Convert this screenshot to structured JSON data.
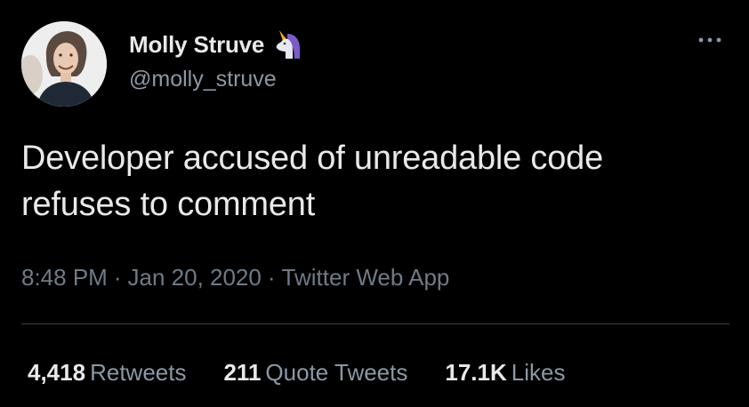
{
  "user": {
    "display_name": "Molly Struve",
    "handle": "@molly_struve",
    "name_emoji": "unicorn-icon",
    "avatar": "avatar-photo"
  },
  "tweet": {
    "text_line1": "Developer accused of unreadable code",
    "text_line2": "refuses to comment"
  },
  "meta": {
    "time": "8:48 PM",
    "separator": "·",
    "date": "Jan 20, 2020",
    "source": "Twitter Web App"
  },
  "stats": {
    "retweets_count": "4,418",
    "retweets_label": "Retweets",
    "quotes_count": "211",
    "quotes_label": "Quote Tweets",
    "likes_count": "17.1K",
    "likes_label": "Likes"
  },
  "actions": {
    "more_icon": "more-dots-icon"
  },
  "colors": {
    "background": "#000000",
    "primary_text": "#e7e9ea",
    "secondary_text": "#8b98a5",
    "divider": "#38444d"
  }
}
